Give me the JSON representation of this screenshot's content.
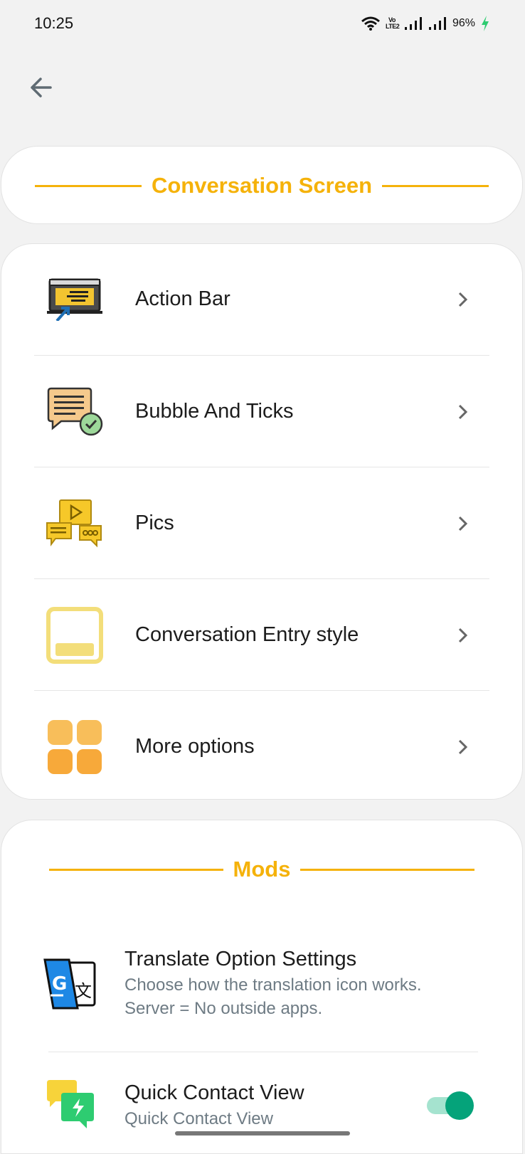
{
  "status_bar": {
    "time": "10:25",
    "volte_badge": "Vo LTE2",
    "battery": "96%",
    "icons": [
      "wifi-icon",
      "volte-icon",
      "signal-icon",
      "signal-icon",
      "charging-icon"
    ]
  },
  "header": {
    "back_icon": "arrow-left-icon",
    "title": "Conversation Screen"
  },
  "menu": {
    "items": [
      {
        "label": "Action Bar",
        "icon": "action-bar-icon"
      },
      {
        "label": "Bubble And Ticks",
        "icon": "bubble-ticks-icon"
      },
      {
        "label": "Pics",
        "icon": "pics-icon"
      },
      {
        "label": "Conversation Entry style",
        "icon": "entry-style-icon"
      },
      {
        "label": "More options",
        "icon": "grid-icon"
      }
    ],
    "chevron_icon": "chevron-right-icon"
  },
  "mods": {
    "title": "Mods",
    "items": [
      {
        "title": "Translate Option Settings",
        "subtitle": "Choose how the translation icon works. Server = No outside apps.",
        "icon": "translate-icon"
      },
      {
        "title": "Quick Contact View",
        "subtitle": "Quick Contact View",
        "icon": "quick-contact-icon",
        "toggle_on": true
      }
    ]
  },
  "colors": {
    "accent": "#f5b20a",
    "toggle_on": "#05a37a",
    "subtitle": "#6e7b84"
  }
}
